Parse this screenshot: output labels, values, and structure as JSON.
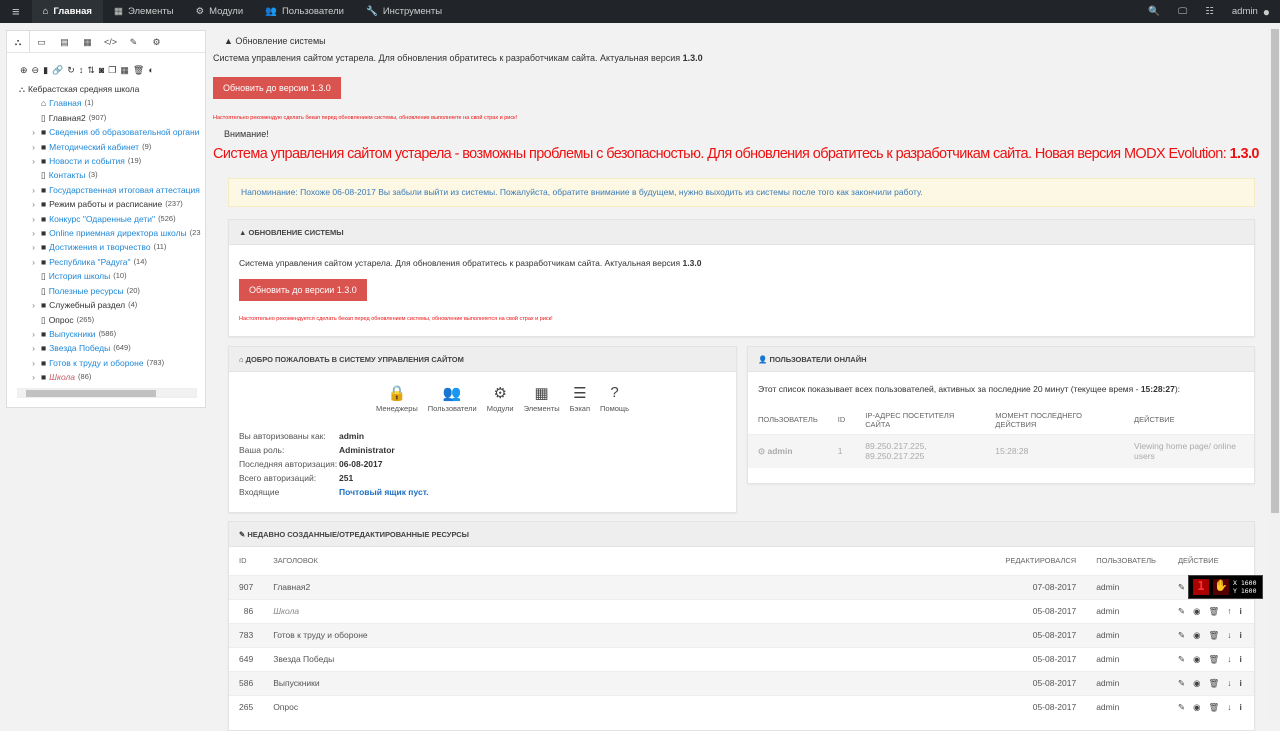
{
  "topbar": {
    "menu_icon": "hamburger-icon",
    "items": [
      {
        "label": "Главная",
        "icon": "home-icon"
      },
      {
        "label": "Элементы",
        "icon": "grid-icon"
      },
      {
        "label": "Модули",
        "icon": "cogs-icon"
      },
      {
        "label": "Пользователи",
        "icon": "users-icon"
      },
      {
        "label": "Инструменты",
        "icon": "wrench-icon"
      }
    ],
    "user": "admin"
  },
  "tree": {
    "root": "Кебрастская средняя школа",
    "items": [
      {
        "label": "Главная",
        "count": "(1)",
        "type": "home",
        "link": true,
        "arrow": false
      },
      {
        "label": "Главная2",
        "count": "(907)",
        "type": "doc",
        "link": false,
        "arrow": false
      },
      {
        "label": "Сведения об образовательной органи",
        "count": "",
        "type": "folder",
        "link": true,
        "arrow": true
      },
      {
        "label": "Методический кабинет",
        "count": "(9)",
        "type": "folder",
        "link": true,
        "arrow": true
      },
      {
        "label": "Новости и события",
        "count": "(19)",
        "type": "folder",
        "link": true,
        "arrow": true
      },
      {
        "label": "Контакты",
        "count": "(3)",
        "type": "doc",
        "link": true,
        "arrow": false
      },
      {
        "label": "Государственная итоговая аттестация",
        "count": "",
        "type": "folder",
        "link": true,
        "arrow": true
      },
      {
        "label": "Режим работы и расписание",
        "count": "(237)",
        "type": "folder",
        "link": false,
        "arrow": true
      },
      {
        "label": "Конкурс \"Одаренные дети\"",
        "count": "(526)",
        "type": "folder",
        "link": true,
        "arrow": true
      },
      {
        "label": "Online приемная директора школы",
        "count": "(23",
        "type": "folder",
        "link": true,
        "arrow": true
      },
      {
        "label": "Достижения и творчество",
        "count": "(11)",
        "type": "folder",
        "link": true,
        "arrow": true
      },
      {
        "label": "Республика \"Радуга\"",
        "count": "(14)",
        "type": "folder",
        "link": true,
        "arrow": true
      },
      {
        "label": "История школы",
        "count": "(10)",
        "type": "doc",
        "link": true,
        "arrow": false
      },
      {
        "label": "Полезные ресурсы",
        "count": "(20)",
        "type": "doc",
        "link": true,
        "arrow": false
      },
      {
        "label": "Служебный раздел",
        "count": "(4)",
        "type": "folder",
        "link": false,
        "arrow": true
      },
      {
        "label": "Опрос",
        "count": "(265)",
        "type": "doc",
        "link": false,
        "arrow": false
      },
      {
        "label": "Выпускники",
        "count": "(586)",
        "type": "folder",
        "link": true,
        "arrow": true
      },
      {
        "label": "Звезда Победы",
        "count": "(649)",
        "type": "folder",
        "link": true,
        "arrow": true
      },
      {
        "label": "Готов к труду и обороне",
        "count": "(783)",
        "type": "folder",
        "link": true,
        "arrow": true
      },
      {
        "label": "Школа",
        "count": "(86)",
        "type": "folder",
        "link": "hidden",
        "arrow": true
      }
    ]
  },
  "top_update": {
    "title": "Обновление системы",
    "text": "Система управления сайтом устарела. Для обновления обратитесь к разработчикам сайта. Актуальная версия ",
    "version": "1.3.0",
    "button": "Обновить до версии 1.3.0",
    "warning": "Настоятельно рекомендую сделать бекап перед обновлением системы, обновление выполняете на свой страх и риск!",
    "attention": "Внимание!",
    "big_warning": "Система управления сайтом устарела - возможны проблемы с безопасностью. Для обновления обратитесь к разработчикам сайта. Новая версия MODX Evolution: ",
    "big_version": "1.3.0"
  },
  "reminder": "Напоминание: Похоже 06-08-2017 Вы забыли выйти из системы. Пожалуйста, обратите внимание в будущем, нужно выходить из системы после того как закончили работу.",
  "update_card": {
    "title": "Обновление системы",
    "text": "Система управления сайтом устарела. Для обновления обратитесь к разработчикам сайта. Актуальная версия ",
    "version": "1.3.0",
    "button": "Обновить до версии 1.3.0",
    "warning": "Настоятельно рекомендуется сделать бекап перед обновлением системы, обновление выполняется на свой страх и риск!"
  },
  "welcome": {
    "title": "Добро пожаловать в систему управления сайтом",
    "icons": [
      {
        "label": "Менеджеры",
        "icon": "lock-icon",
        "glyph": "🔒"
      },
      {
        "label": "Пользователи",
        "icon": "users-icon",
        "glyph": "👥"
      },
      {
        "label": "Модули",
        "icon": "cogs-icon",
        "glyph": "⚙"
      },
      {
        "label": "Элементы",
        "icon": "grid-icon",
        "glyph": "▦"
      },
      {
        "label": "Бэкап",
        "icon": "database-icon",
        "glyph": "☰"
      },
      {
        "label": "Помощь",
        "icon": "help-icon",
        "glyph": "?"
      }
    ],
    "info": [
      {
        "k": "Вы авторизованы как:",
        "v": "admin"
      },
      {
        "k": "Ваша роль:",
        "v": "Administrator"
      },
      {
        "k": "Последняя авторизация:",
        "v": "06-08-2017"
      },
      {
        "k": "Всего авторизаций:",
        "v": "251"
      },
      {
        "k": "Входящие",
        "v": "Почтовый ящик пуст.",
        "link": true
      }
    ]
  },
  "online": {
    "title": "Пользователи онлайн",
    "text": "Этот список показывает всех пользователей, активных за последние 20 минут (текущее время - ",
    "time": "15:28:27",
    "text_end": "):",
    "columns": [
      "Пользователь",
      "ID",
      "IP-адрес посетителя сайта",
      "Момент последнего действия",
      "Действие"
    ],
    "rows": [
      {
        "user": "admin",
        "id": "1",
        "ip": "89.250.217.225, 89.250.217.225",
        "time": "15:28:28",
        "action": "Viewing home page/ online users"
      }
    ]
  },
  "recent": {
    "title": "Недавно созданные/отредактированные ресурсы",
    "columns": [
      "ID",
      "Заголовок",
      "Редактировался",
      "Пользователь",
      "Действие"
    ],
    "rows": [
      {
        "id": "907",
        "title": "Главная2",
        "date": "07-08-2017",
        "user": "admin",
        "move": "up"
      },
      {
        "id": "86",
        "title": "Школа",
        "date": "05-08-2017",
        "user": "admin",
        "move": "up",
        "italic": true
      },
      {
        "id": "783",
        "title": "Готов к труду и обороне",
        "date": "05-08-2017",
        "user": "admin",
        "move": "down"
      },
      {
        "id": "649",
        "title": "Звезда Победы",
        "date": "05-08-2017",
        "user": "admin",
        "move": "down"
      },
      {
        "id": "586",
        "title": "Выпускники",
        "date": "05-08-2017",
        "user": "admin",
        "move": "down"
      },
      {
        "id": "265",
        "title": "Опрос",
        "date": "05-08-2017",
        "user": "admin",
        "move": "down"
      }
    ]
  },
  "overlay": {
    "x": "X 1600",
    "y": "Y 1600"
  }
}
